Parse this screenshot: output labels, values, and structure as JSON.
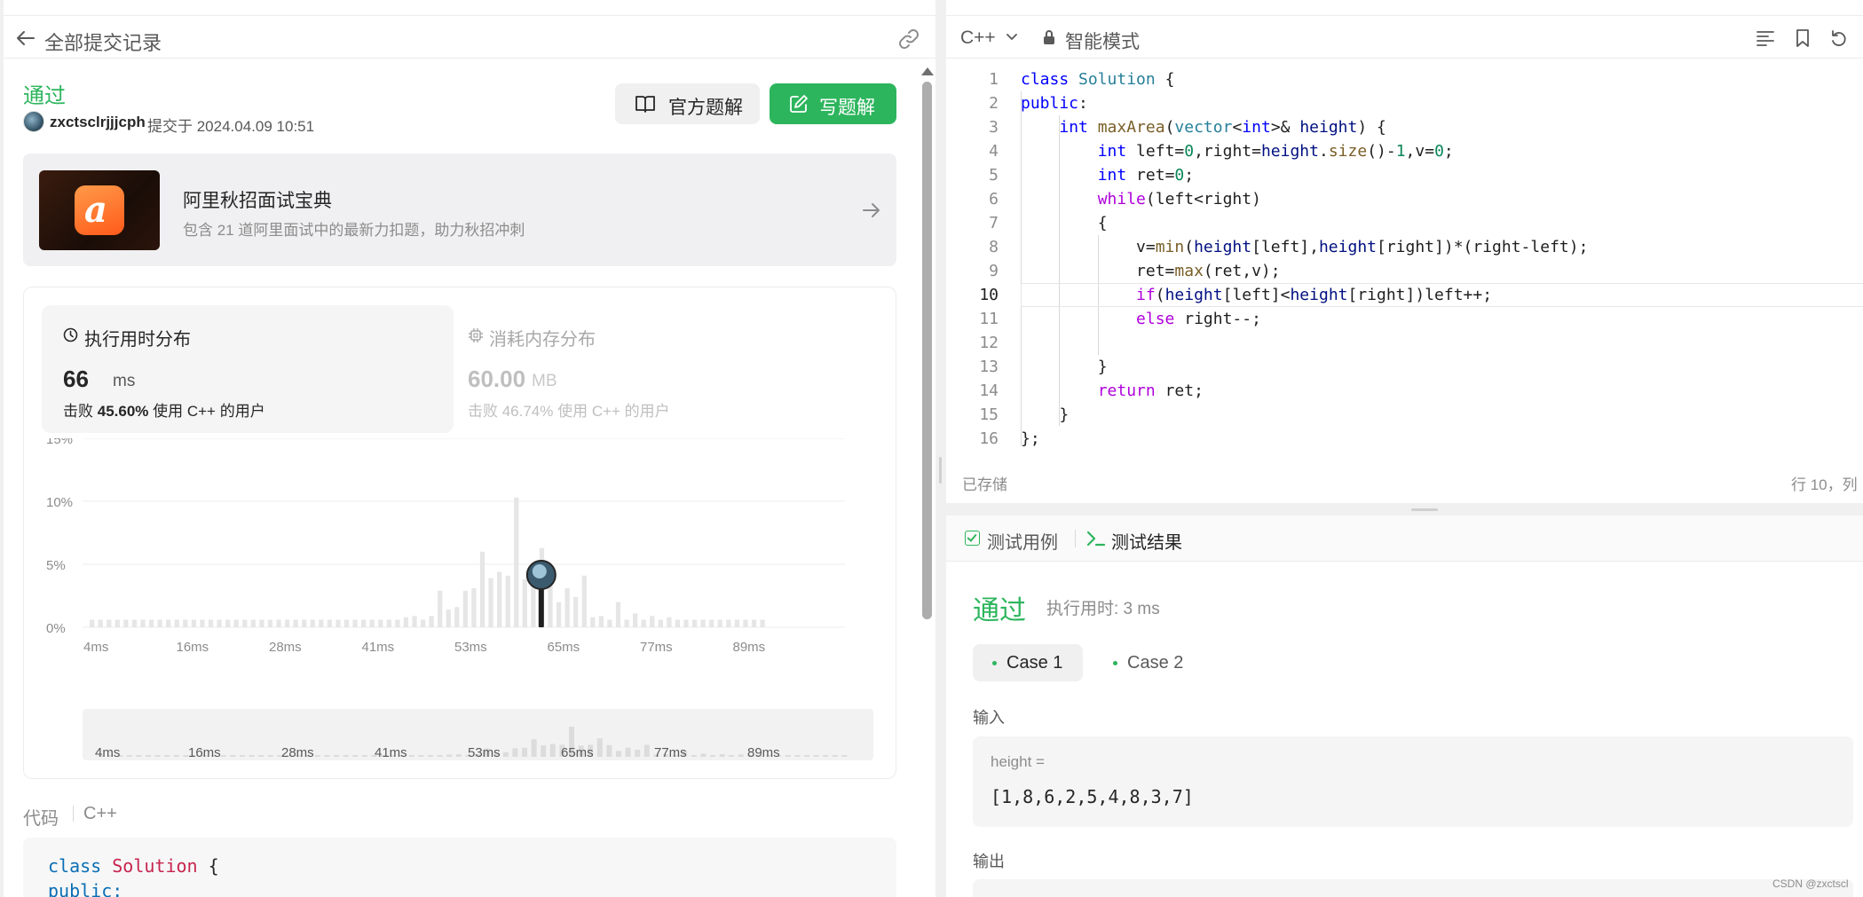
{
  "left_header": {
    "back_label": "全部提交记录"
  },
  "submission": {
    "status": "通过",
    "user": "zxctsclrjjjcph",
    "time": "提交于 2024.04.09 10:51",
    "official_button": "官方题解",
    "write_button": "写题解"
  },
  "promo": {
    "title": "阿里秋招面试宝典",
    "desc": "包含 21 道阿里面试中的最新力扣题，助力秋招冲刺"
  },
  "runtime": {
    "title": "执行用时分布",
    "value": "66",
    "unit": "ms",
    "beat": "击败 45.60% 使用 C++ 的用户",
    "beat_percent": "45.60%"
  },
  "memory": {
    "title": "消耗内存分布",
    "value": "60.00",
    "unit": "MB",
    "beat": "击败 46.74% 使用 C++ 的用户"
  },
  "chart_data": {
    "type": "bar",
    "title": "",
    "xlabel": "",
    "ylabel": "",
    "y_ticks": [
      "15%",
      "10%",
      "5%",
      "0%"
    ],
    "ylim": [
      0,
      15
    ],
    "x_ticks": [
      "4ms",
      "16ms",
      "28ms",
      "41ms",
      "53ms",
      "65ms",
      "77ms",
      "89ms"
    ],
    "values": [
      0.6,
      0.6,
      0.6,
      0.6,
      0.6,
      0.6,
      0.6,
      0.6,
      0.6,
      0.6,
      0.6,
      0.6,
      0.6,
      0.6,
      0.6,
      0.6,
      0.6,
      0.6,
      0.6,
      0.6,
      0.6,
      0.6,
      0.6,
      0.6,
      0.6,
      0.6,
      0.6,
      0.6,
      0.6,
      0.6,
      0.6,
      0.6,
      0.6,
      0.6,
      0.6,
      0.6,
      0.6,
      0.8,
      0.9,
      0.6,
      0.9,
      2.9,
      1.4,
      1.6,
      2.9,
      3.1,
      6.0,
      3.9,
      4.4,
      4.1,
      10.3,
      3.8,
      4.1,
      6.3,
      4.0,
      2.0,
      3.1,
      2.4,
      4.1,
      0.8,
      0.9,
      0.6,
      2.0,
      0.6,
      1.1,
      0.6,
      0.9,
      0.6,
      0.8,
      0.6,
      0.6,
      0.6,
      0.6,
      0.6,
      0.6,
      0.6,
      0.6,
      0.6,
      0.6,
      0.6
    ],
    "highlight_value": 3.7,
    "highlight_label": "66ms"
  },
  "code_section": {
    "label": "代码",
    "lang": "C++",
    "preview_line1": "class Solution {",
    "preview_line2": "public:"
  },
  "editor": {
    "lang": "C++",
    "mode": "智能模式",
    "saved": "已存储",
    "cursor": "行 10，列",
    "active_line": 10
  },
  "tests": {
    "tab_cases": "测试用例",
    "tab_result": "测试结果",
    "status": "通过",
    "runtime": "执行用时: 3 ms",
    "case1": "Case 1",
    "case2": "Case 2",
    "input_label": "输入",
    "input_name": "height =",
    "input_value": "[1,8,6,2,5,4,8,3,7]",
    "output_label": "输出"
  },
  "watermark": "CSDN @zxctscl"
}
